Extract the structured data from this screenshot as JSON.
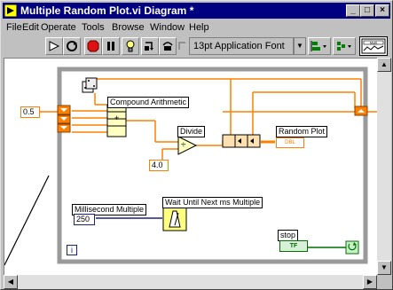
{
  "window": {
    "title": "Multiple Random Plot.vi Diagram *"
  },
  "caption_buttons": {
    "minimize": "_",
    "maximize": "□",
    "close": "×"
  },
  "menu": [
    "File",
    "Edit",
    "Operate",
    "Tools",
    "Browse",
    "Window",
    "Help"
  ],
  "toolbar": {
    "font": "13pt Application Font"
  },
  "diagram": {
    "constant_left": "0.5",
    "compound_arithmetic": "Compound Arithmetic",
    "compound_symbol": "+",
    "divide_label": "Divide",
    "divide_symbol": "÷",
    "constant_divisor": "4.0",
    "random_plot": "Random Plot",
    "random_plot_terminal": "DBL",
    "ms_multiple": "Millisecond Multiple",
    "ms_value": "250",
    "wait_label": "Wait Until Next ms Multiple",
    "stop_label": "stop",
    "stop_terminal": "TF",
    "loop_index": "i"
  },
  "colors": {
    "title_bg": "#000080",
    "wire_orange": "#ff8000",
    "wire_blue": "#1a237e",
    "wire_green": "#007000",
    "loop_gray": "#9a9a9a"
  }
}
